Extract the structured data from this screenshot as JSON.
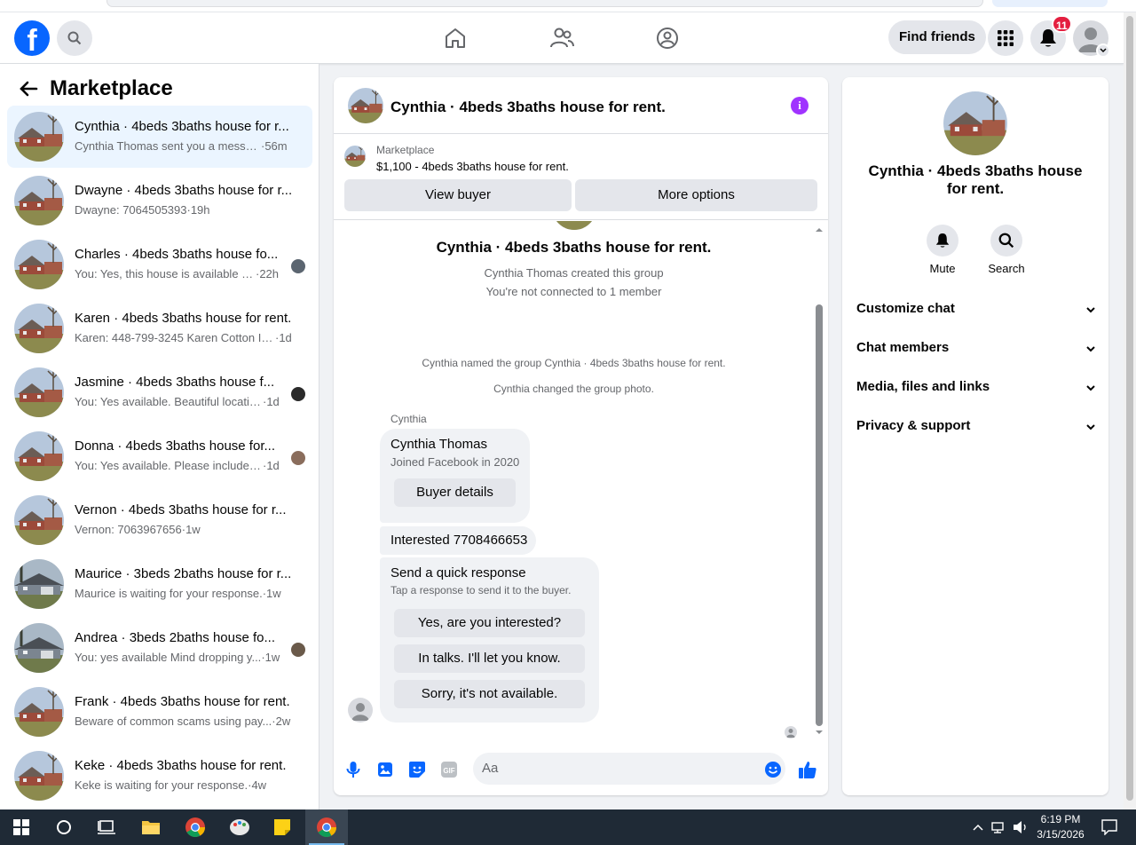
{
  "header": {
    "logo": "f",
    "find_friends": "Find friends",
    "notif_count": "11"
  },
  "sidebar": {
    "title": "Marketplace",
    "conversations": [
      {
        "name": "Cynthia · 4beds 3baths house for r...",
        "preview": "Cynthia Thomas sent you a messag...",
        "time": "·56m",
        "active": true
      },
      {
        "name": "Dwayne · 4beds 3baths house for r...",
        "preview": "Dwayne: 7064505393",
        "time": "·19h"
      },
      {
        "name": "Charles · 4beds 3baths house fo...",
        "preview": "You: Yes, this house is available if ...",
        "time": "·22h"
      },
      {
        "name": "Karen · 4beds 3baths house for rent.",
        "preview": "Karen: 448-799-3245 Karen Cotton I r...",
        "time": "·1d"
      },
      {
        "name": "Jasmine · 4beds 3baths house f...",
        "preview": "You: Yes available. Beautiful locatio...",
        "time": "·1d"
      },
      {
        "name": "Donna · 4beds 3baths house for...",
        "preview": "You: Yes available. Please include y...",
        "time": "·1d"
      },
      {
        "name": "Vernon · 4beds 3baths house for r...",
        "preview": "Vernon: 7063967656",
        "time": "·1w"
      },
      {
        "name": "Maurice · 3beds 2baths house for r...",
        "preview": "Maurice is waiting for your response.",
        "time": "·1w"
      },
      {
        "name": "Andrea · 3beds 2baths house fo...",
        "preview": "You: yes available Mind dropping y...",
        "time": "·1w"
      },
      {
        "name": "Frank · 4beds 3baths house for rent.",
        "preview": "Beware of common scams using pay...",
        "time": "·2w"
      },
      {
        "name": "Keke · 4beds 3baths house for rent.",
        "preview": "Keke is waiting for your response.",
        "time": "·4w"
      }
    ]
  },
  "chat": {
    "title": "Cynthia · 4beds 3baths house for rent.",
    "marketplace_label": "Marketplace",
    "listing": "$1,100 - 4beds 3baths house for rent.",
    "view_buyer": "View buyer",
    "more_options": "More options",
    "group_title": "Cynthia · 4beds 3baths house for rent.",
    "created": "Cynthia Thomas created this group",
    "not_connected": "You're not connected to 1 member",
    "named_event": "Cynthia named the group Cynthia · 4beds 3baths house for rent.",
    "photo_event": "Cynthia changed the group photo.",
    "sender": "Cynthia",
    "buyer_name": "Cynthia Thomas",
    "buyer_joined": "Joined Facebook in 2020",
    "buyer_details": "Buyer details",
    "message": "Interested 7708466653",
    "quick_title": "Send a quick response",
    "quick_sub": "Tap a response to send it to the buyer.",
    "quick_responses": [
      "Yes, are you interested?",
      "In talks. I'll let you know.",
      "Sorry, it's not available."
    ],
    "composer_placeholder": "Aa"
  },
  "details": {
    "title": "Cynthia · 4beds 3baths house for rent.",
    "mute": "Mute",
    "search": "Search",
    "sections": [
      "Customize chat",
      "Chat members",
      "Media, files and links",
      "Privacy & support"
    ]
  },
  "taskbar": {
    "time": "6:19 PM",
    "date": "3/15/2026"
  },
  "colors": {
    "brand": "#0866ff",
    "active_row": "#ebf5ff",
    "badge": "#e41e3f",
    "info": "#a033ff"
  }
}
